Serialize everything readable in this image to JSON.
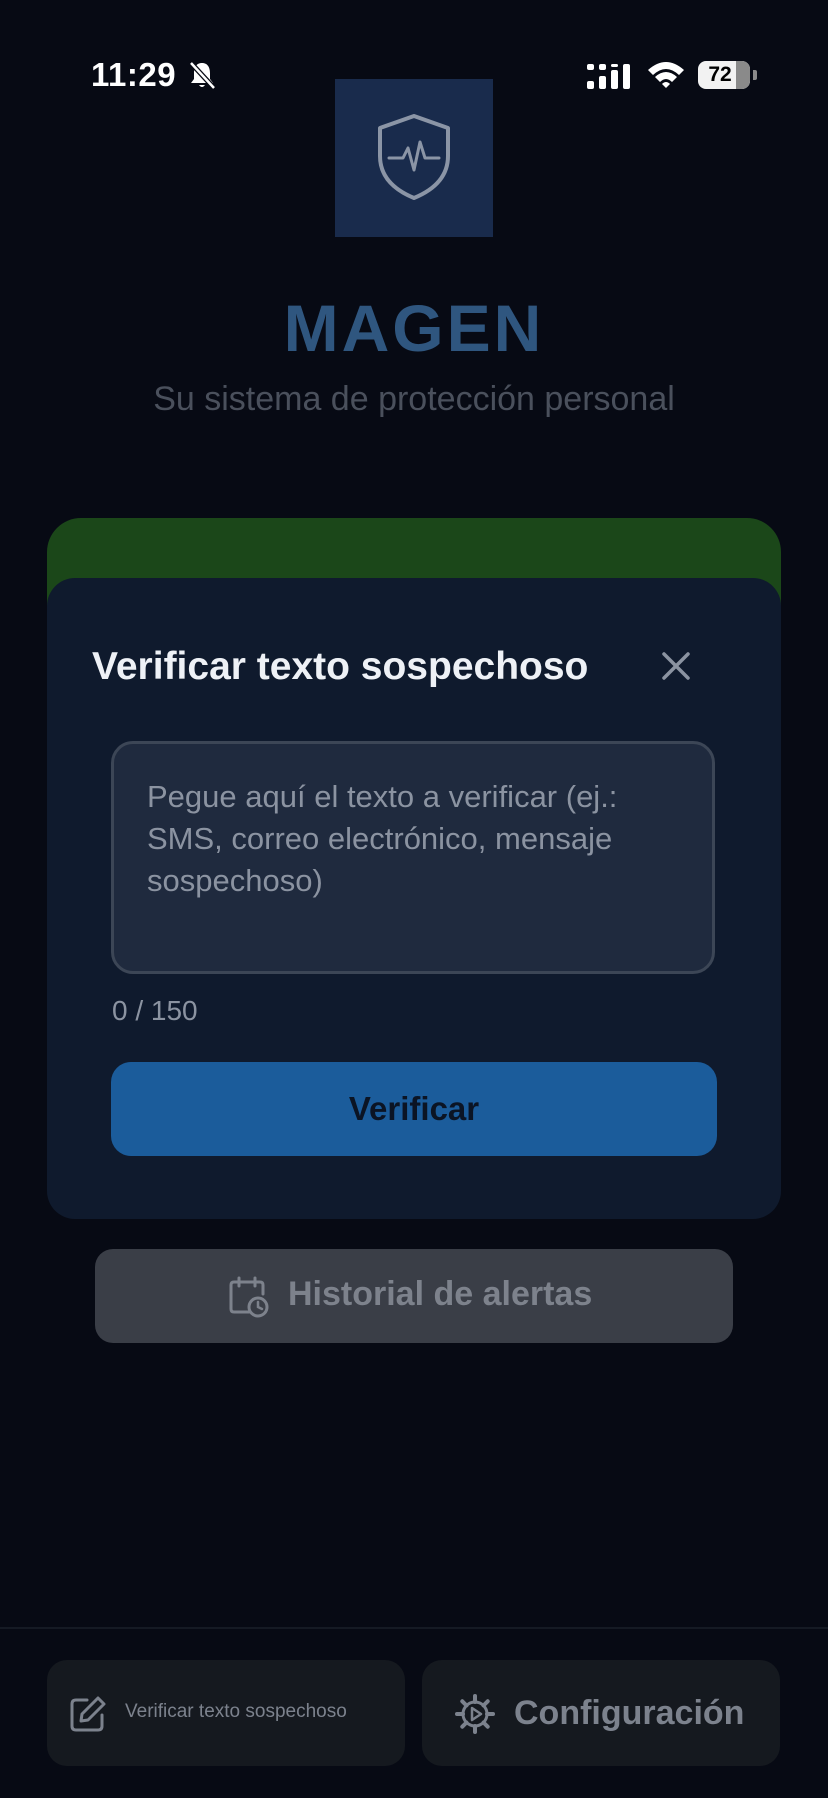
{
  "status_bar": {
    "time": "11:29",
    "battery_level": "72",
    "icons": [
      "bell-slash-icon",
      "signal-icon",
      "wifi-icon",
      "battery-icon"
    ]
  },
  "app": {
    "logo_icon": "shield-heartbeat-icon",
    "title": "MAGEN",
    "subtitle": "Su sistema de protección personal"
  },
  "modal": {
    "title": "Verificar texto sospechoso",
    "close_icon": "close-icon",
    "input": {
      "value": "",
      "placeholder": "Pegue aquí el texto a verificar (ej.: SMS, correo electrónico, mensaje sospechoso)"
    },
    "counter": "0 / 150",
    "verify_label": "Verificar"
  },
  "history_button": {
    "label": "Historial de alertas",
    "icon": "calendar-clock-icon"
  },
  "bottom_bar": {
    "verify_text_label": "Verificar texto sospechoso",
    "verify_text_icon": "edit-icon",
    "settings_label": "Configuración",
    "settings_icon": "gear-icon"
  },
  "colors": {
    "background": "#070a14",
    "accent_blue": "#1b5c9b",
    "logo_bg": "#192b4c",
    "title_blue": "#2f567f",
    "green_card": "#1b4719",
    "modal_bg": "#0f1a2d"
  }
}
